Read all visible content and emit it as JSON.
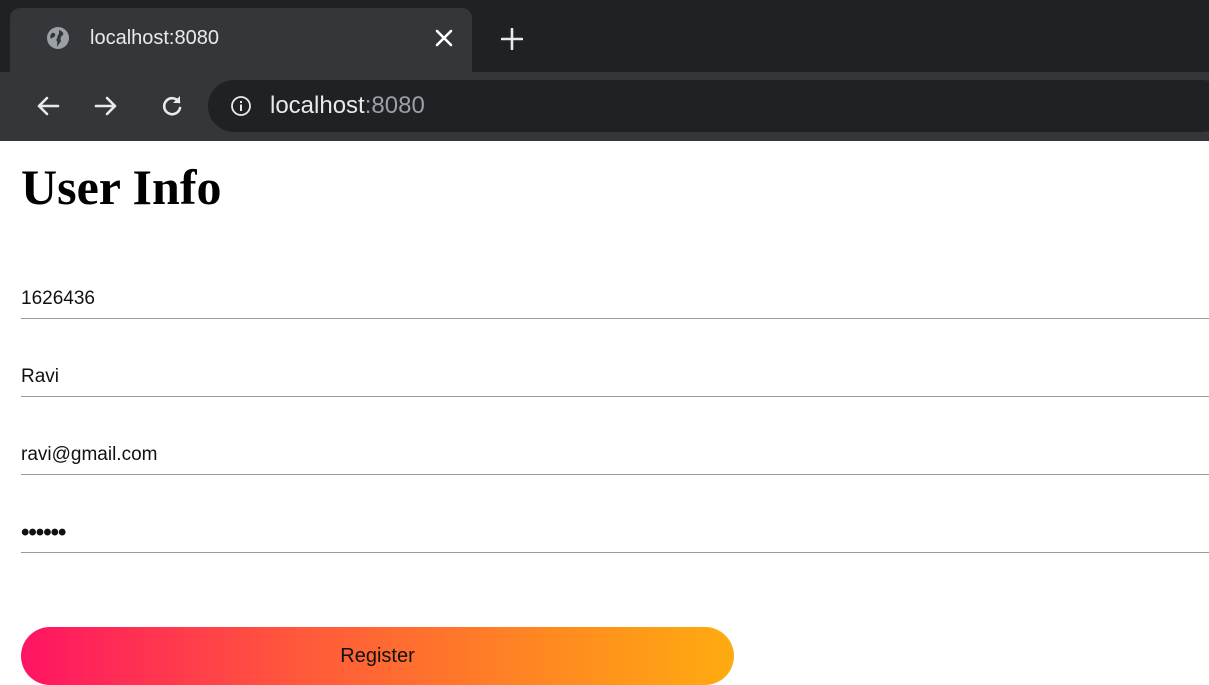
{
  "browser": {
    "tab": {
      "title": "localhost:8080",
      "close_glyph": "✕",
      "icon": "globe-icon"
    },
    "new_tab_glyph": "+",
    "toolbar": {
      "back_icon": "arrow-left-icon",
      "forward_icon": "arrow-right-icon",
      "reload_icon": "reload-icon"
    },
    "address": {
      "host": "localhost",
      "port": ":8080",
      "info_icon": "info-icon"
    },
    "colors": {
      "frame": "#202124",
      "toolbar": "#35363a",
      "text": "#e8eaed",
      "muted": "#9aa0a6"
    }
  },
  "page": {
    "title": "User Info",
    "form": {
      "fields": [
        {
          "name": "id",
          "value": "1626436"
        },
        {
          "name": "name",
          "value": "Ravi"
        },
        {
          "name": "email",
          "value": "ravi@gmail.com"
        },
        {
          "name": "password",
          "value": "••••••"
        }
      ],
      "register_label": "Register",
      "button_gradient": [
        "#ff1463",
        "#ffab10"
      ]
    }
  }
}
